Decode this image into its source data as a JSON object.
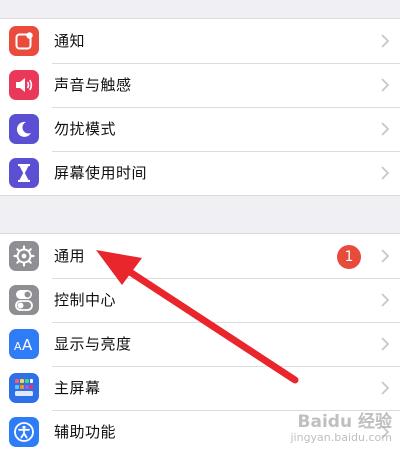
{
  "settings": {
    "group1": [
      {
        "label": "通知",
        "icon": "notification-icon",
        "color": "#e94b3c"
      },
      {
        "label": "声音与触感",
        "icon": "speaker-icon",
        "color": "#e9385a"
      },
      {
        "label": "勿扰模式",
        "icon": "moon-icon",
        "color": "#5b4fd3"
      },
      {
        "label": "屏幕使用时间",
        "icon": "hourglass-icon",
        "color": "#5b4fd3"
      }
    ],
    "group2": [
      {
        "label": "通用",
        "icon": "gear-icon",
        "color": "#8e8e93",
        "badge": "1"
      },
      {
        "label": "控制中心",
        "icon": "toggles-icon",
        "color": "#8e8e93"
      },
      {
        "label": "显示与亮度",
        "icon": "text-size-icon",
        "color": "#2f7cf6"
      },
      {
        "label": "主屏幕",
        "icon": "home-grid-icon",
        "color": "#2f6fe8"
      },
      {
        "label": "辅助功能",
        "icon": "accessibility-icon",
        "color": "#2f7cf6"
      }
    ]
  },
  "annotation": {
    "color": "#e8262b"
  },
  "watermark": {
    "brand": "Baidu 经验",
    "url": "jingyan.baidu.com"
  }
}
